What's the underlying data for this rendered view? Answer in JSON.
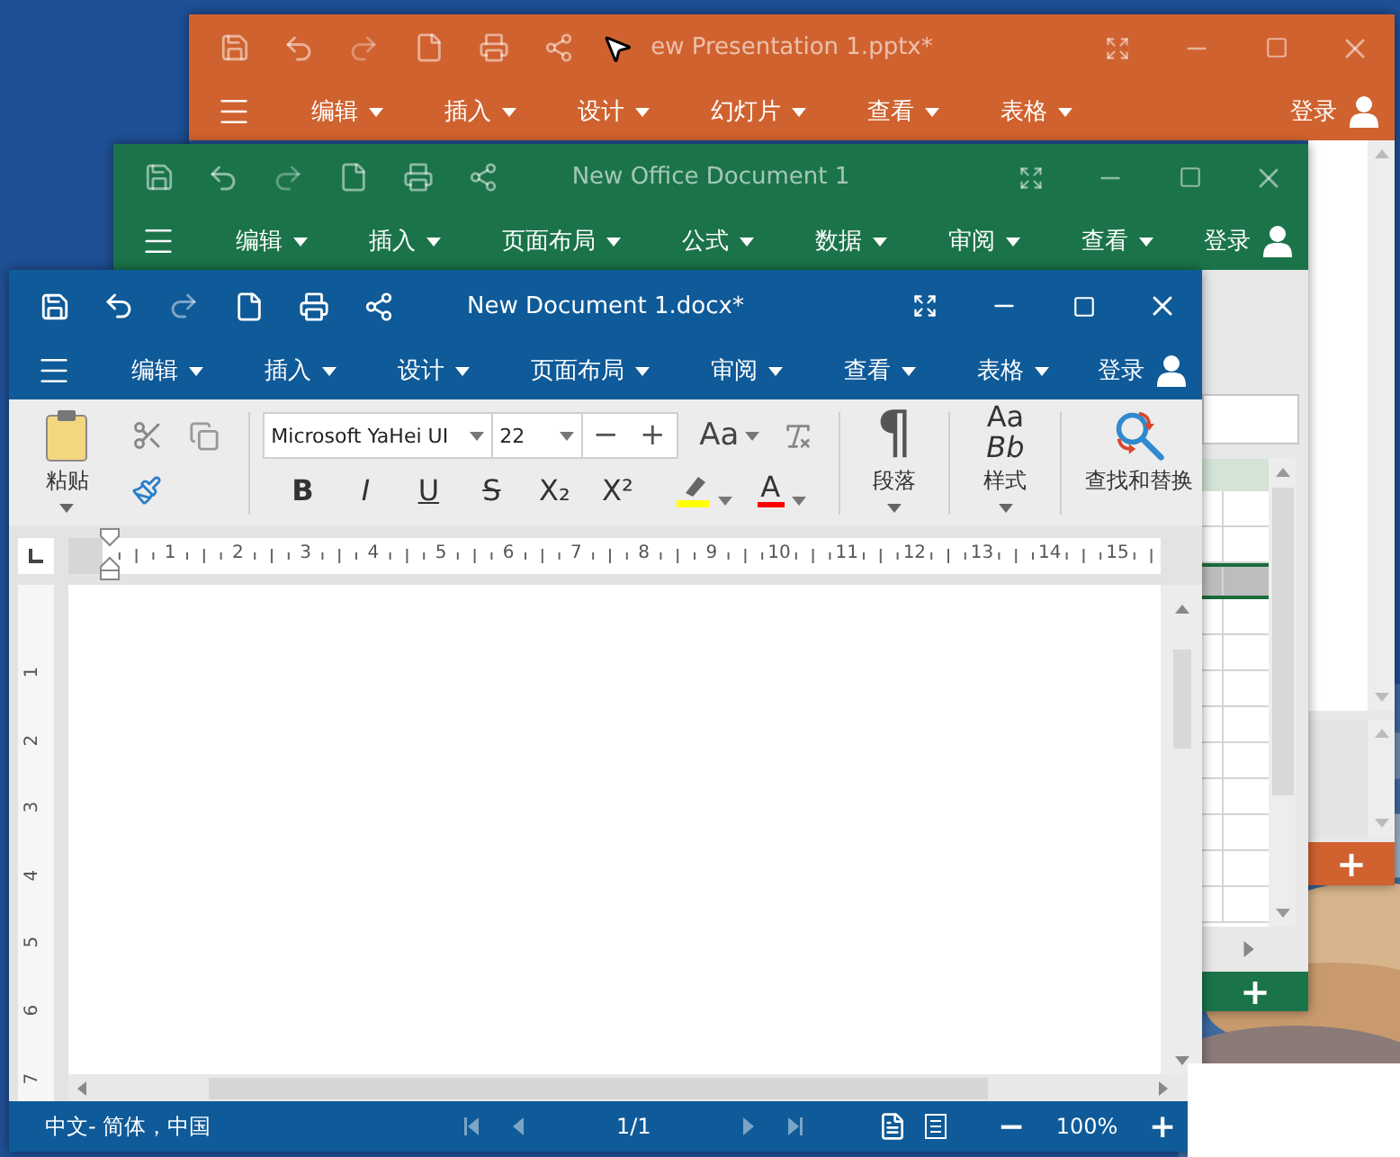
{
  "windows": [
    {
      "kind": "presentation",
      "title": "ew Presentation 1.pptx*",
      "mouse_pointer": true,
      "menus": [
        "编辑",
        "插入",
        "设计",
        "幻灯片",
        "查看",
        "表格"
      ],
      "login": "登录",
      "add_button": "+"
    },
    {
      "kind": "spreadsheet",
      "title": "New Office Document 1",
      "menus": [
        "编辑",
        "插入",
        "页面布局",
        "公式",
        "数据",
        "审阅",
        "查看"
      ],
      "login": "登录",
      "add_button": "+"
    },
    {
      "kind": "document",
      "title": "New Document 1.docx*",
      "menus": [
        "编辑",
        "插入",
        "设计",
        "页面布局",
        "审阅",
        "查看",
        "表格"
      ],
      "login": "登录",
      "ribbon": {
        "paste": "粘贴",
        "font": "Microsoft YaHei UI",
        "size": "22",
        "size_down": "−",
        "size_up": "+",
        "change_case": "Aa",
        "format_buttons": [
          {
            "kind": "bold",
            "label": "B"
          },
          {
            "kind": "italic",
            "label": "I"
          },
          {
            "kind": "underline",
            "label": "U"
          },
          {
            "kind": "strike",
            "label": "S"
          },
          {
            "kind": "subscript",
            "label": "X₂"
          },
          {
            "kind": "superscript",
            "label": "X²"
          }
        ],
        "font_color": "A",
        "paragraph_icon": "¶",
        "paragraph": "段落",
        "styles_preview": [
          "Aa",
          "Bb"
        ],
        "styles": "样式",
        "find_replace": "查找和替换"
      },
      "ruler": [
        "1",
        "2",
        "3",
        "4",
        "5",
        "6",
        "7",
        "8",
        "9",
        "10",
        "11",
        "12",
        "13",
        "14",
        "15"
      ],
      "vertical_ruler": [
        "1",
        "2",
        "3",
        "4",
        "5",
        "6",
        "7"
      ],
      "status_bar": {
        "language": "中文- 简体，中国",
        "page": "1/1",
        "zoom_out": "−",
        "zoom": "100%",
        "zoom_in": "+"
      }
    }
  ]
}
